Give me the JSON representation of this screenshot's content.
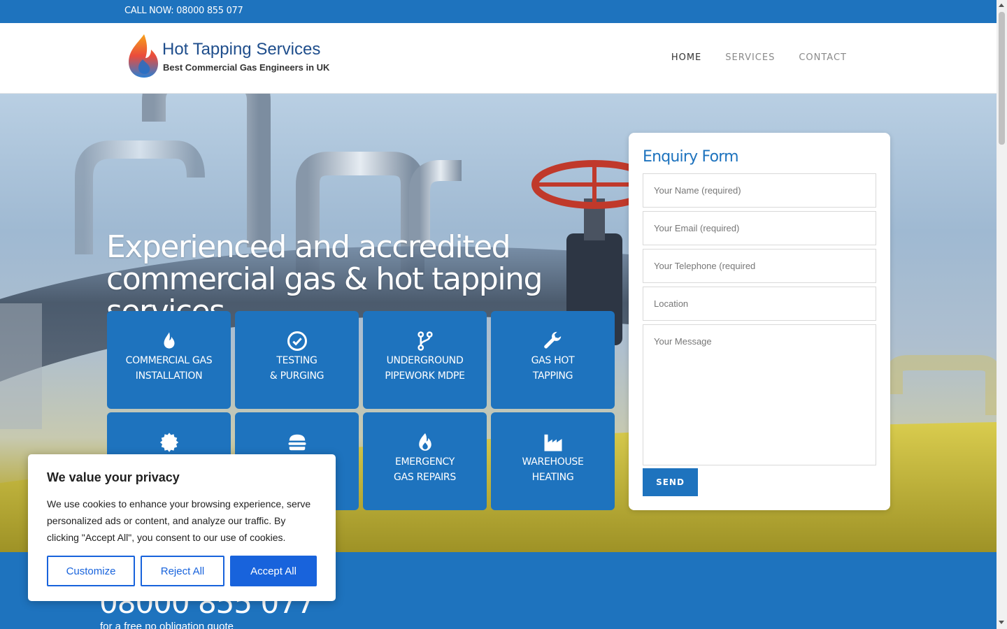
{
  "topbar": {
    "phone_text": "CALL NOW: 08000 855 077"
  },
  "header": {
    "brand": "Hot Tapping Services",
    "tagline": "Best Commercial Gas Engineers in UK",
    "nav": [
      {
        "label": "HOME",
        "active": true
      },
      {
        "label": "SERVICES",
        "active": false
      },
      {
        "label": "CONTACT",
        "active": false
      }
    ]
  },
  "hero": {
    "heading_line1": "Experienced and accredited",
    "heading_line2": "commercial gas & hot tapping services",
    "services": [
      {
        "icon": "flame-icon",
        "line1": "COMMERCIAL GAS",
        "line2": "INSTALLATION"
      },
      {
        "icon": "check-circle-icon",
        "line1": "TESTING",
        "line2": "& PURGING"
      },
      {
        "icon": "code-branch-icon",
        "line1": "UNDERGROUND",
        "line2": "PIPEWORK MDPE"
      },
      {
        "icon": "wrench-icon",
        "line1": "GAS HOT",
        "line2": "TAPPING"
      },
      {
        "icon": "certificate-icon",
        "line1": "",
        "line2": ""
      },
      {
        "icon": "burger-icon",
        "line1": "",
        "line2": ""
      },
      {
        "icon": "fire-icon",
        "line1": "EMERGENCY",
        "line2": "GAS REPAIRS"
      },
      {
        "icon": "industry-icon",
        "line1": "WAREHOUSE",
        "line2": "HEATING"
      }
    ]
  },
  "enquiry": {
    "title": "Enquiry Form",
    "name_placeholder": "Your Name (required)",
    "email_placeholder": "Your Email (required)",
    "phone_placeholder": "Your Telephone (required",
    "location_placeholder": "Location",
    "message_placeholder": "Your Message",
    "send_label": "SEND"
  },
  "cta": {
    "phone": "08000 855 077",
    "subtext": "for a free no obligation quote"
  },
  "cookie": {
    "title": "We value your privacy",
    "body": "We use cookies to enhance your browsing experience, serve personalized ads or content, and analyze our traffic. By clicking \"Accept All\", you consent to our use of cookies.",
    "customize_label": "Customize",
    "reject_label": "Reject All",
    "accept_label": "Accept All"
  },
  "colors": {
    "brand_blue": "#1e73be",
    "cookie_blue": "#1863dc"
  }
}
